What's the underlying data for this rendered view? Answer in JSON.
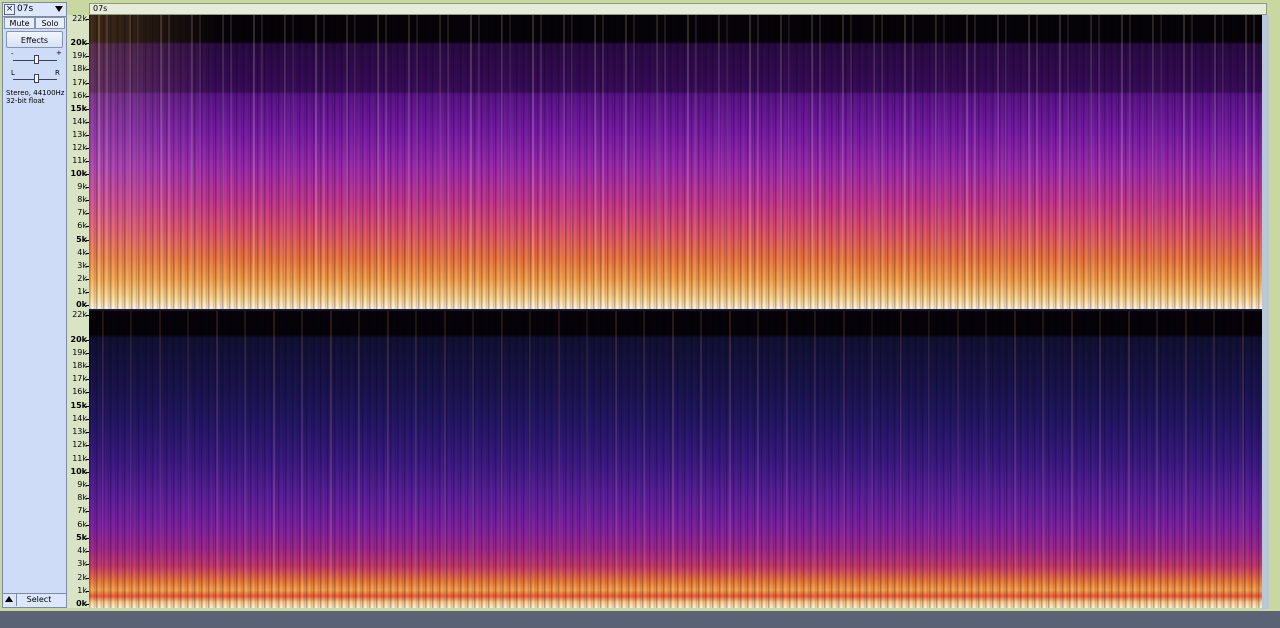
{
  "track": {
    "name": "07s",
    "close_symbol": "×",
    "mute_label": "Mute",
    "solo_label": "Solo",
    "effects_label": "Effects",
    "gain_minus": "-",
    "gain_plus": "+",
    "pan_left": "L",
    "pan_right": "R",
    "info_line1": "Stereo, 44100Hz",
    "info_line2": "32-bit float",
    "select_label": "Select"
  },
  "clip": {
    "name": "07s"
  },
  "ruler": {
    "labels": [
      "22k",
      "20k",
      "19k",
      "18k",
      "17k",
      "16k",
      "15k",
      "14k",
      "13k",
      "12k",
      "11k",
      "10k",
      "9k",
      "8k",
      "7k",
      "6k",
      "5k",
      "4k",
      "3k",
      "2k",
      "1k",
      "0k"
    ]
  },
  "colors": {
    "spectrogram_high": "#fff6e0",
    "spectrogram_mid": "#f08a3a",
    "spectrogram_low": "#8a1fb8",
    "spectrogram_bg": "#140a3a",
    "spectrogram_silence": "#050208"
  }
}
